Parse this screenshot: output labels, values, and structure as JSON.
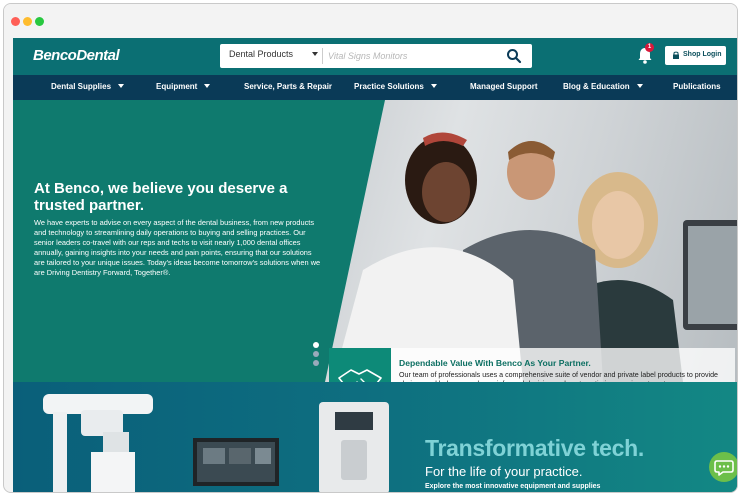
{
  "window": {
    "controls": [
      "close",
      "minimize",
      "zoom"
    ]
  },
  "header": {
    "logo": "BencoDental",
    "search": {
      "category": "Dental Products",
      "placeholder": "Vital Signs Monitors"
    },
    "notifications_count": "1",
    "login_label": "Shop Login"
  },
  "nav": {
    "items": [
      {
        "label": "Dental Supplies",
        "dropdown": true
      },
      {
        "label": "Equipment",
        "dropdown": true
      },
      {
        "label": "Service, Parts & Repair",
        "dropdown": false
      },
      {
        "label": "Practice Solutions",
        "dropdown": true
      },
      {
        "label": "Managed Support",
        "dropdown": false
      },
      {
        "label": "Blog & Education",
        "dropdown": true
      },
      {
        "label": "Publications",
        "dropdown": false
      }
    ]
  },
  "hero": {
    "title": "At Benco, we believe you deserve a trusted partner.",
    "body": "We have experts to advise on every aspect of the dental business, from new products and technology to streamlining daily operations to buying and selling practices. Our senior leaders co-travel with our reps and techs to visit nearly 1,000 dental offices annually, gaining insights into your needs and pain points, ensuring that our solutions are tailored to your unique issues. Today's ideas become tomorrow's solutions when we are Driving Dentistry Forward, Together®.",
    "slides_total": 3,
    "active_slide": 1,
    "callout": {
      "icon": "handshake-icon",
      "title": "Dependable Value With Benco As Your Partner.",
      "text": "Our team of professionals uses a comprehensive suite of vendor and private label products to provide choices and help you make an informed decision on how to optimize your investment."
    }
  },
  "promo": {
    "title": "Transformative tech.",
    "subtitle": "For the life of your practice.",
    "tagline": "Explore the most innovative equipment and supplies"
  },
  "colors": {
    "teal": "#0b6f73",
    "navy": "#0a3a57",
    "accent": "#7fd2d6",
    "chat": "#6cbf4a"
  }
}
